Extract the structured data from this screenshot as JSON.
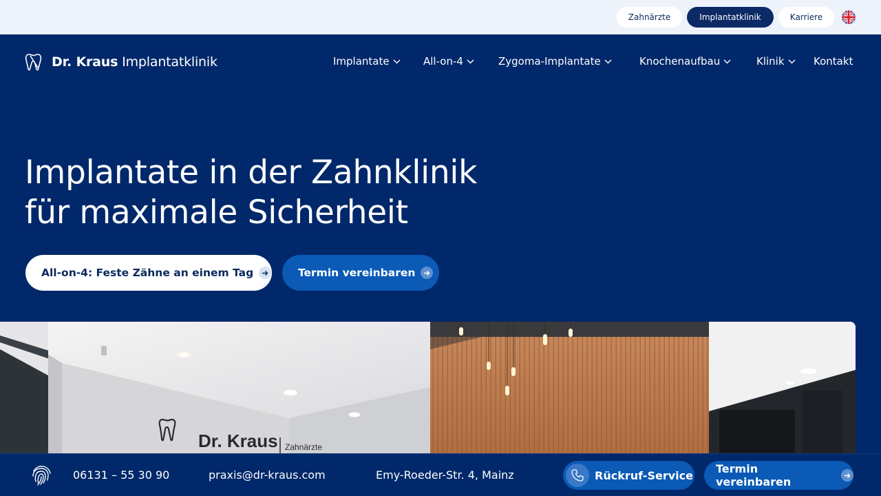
{
  "topbar": {
    "links": [
      "Zahnärzte",
      "Implantatklinik",
      "Karriere"
    ],
    "active": "Implantatklinik",
    "language_icon": "uk-flag-icon"
  },
  "logo": {
    "bold": "Dr. Kraus",
    "light": "Implantatklinik",
    "icon": "tooth-icon"
  },
  "nav": {
    "items": [
      {
        "label": "Implantate",
        "dropdown": true
      },
      {
        "label": "All-on-4",
        "dropdown": true
      },
      {
        "label": "Zygoma-Implantate",
        "dropdown": true
      },
      {
        "label": "Knochenaufbau",
        "dropdown": true
      },
      {
        "label": "Klinik",
        "dropdown": true
      },
      {
        "label": "Kontakt",
        "dropdown": false
      }
    ]
  },
  "hero": {
    "title_line1": "Implantate in der Zahnklinik",
    "title_line2": "für maximale Sicherheit",
    "cta_primary": "All-on-4: Feste Zähne an einem Tag",
    "cta_secondary": "Termin vereinbaren"
  },
  "photo": {
    "sign_name": "Dr. Kraus",
    "sign_sub": "Zahnärzte"
  },
  "bottombar": {
    "icon": "fingerprint-icon",
    "phone": "06131 – 55 30 90",
    "email": "praxis@dr-kraus.com",
    "address": "Emy-Roeder-Str. 4, Mainz",
    "callback_label": "Rückruf-Service",
    "appointment_label": "Termin vereinbaren"
  },
  "colors": {
    "primary_navy": "#00286a",
    "accent_blue": "#0a5ab6",
    "topbar_bg": "#eef3fb"
  }
}
